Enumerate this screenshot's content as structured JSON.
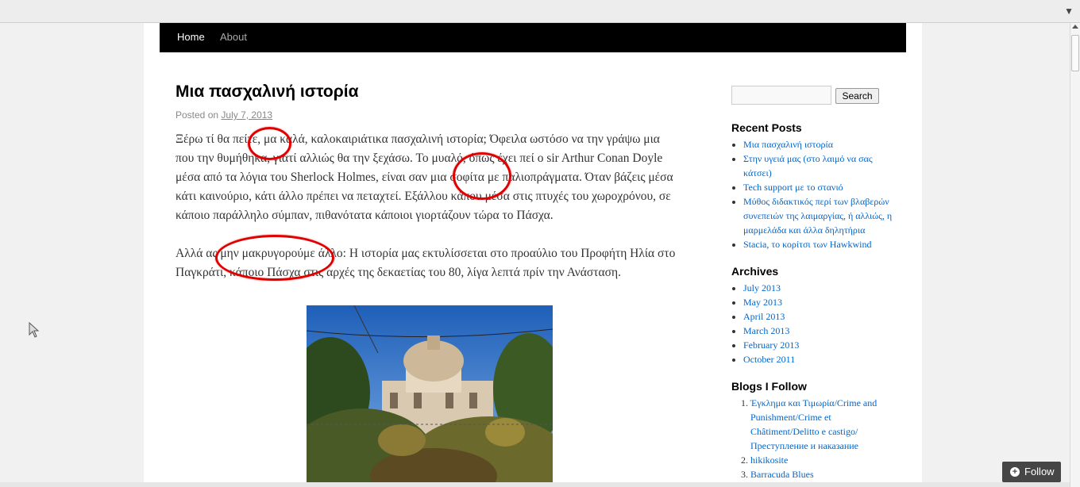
{
  "browser": {
    "dropdown_icon": "chevron-down-icon"
  },
  "nav": {
    "items": [
      {
        "label": "Home",
        "active": true
      },
      {
        "label": "About",
        "active": false
      }
    ]
  },
  "post": {
    "title": "Μια πασχαλινή ιστορία",
    "posted_on_label": "Posted on",
    "date": "July 7, 2013",
    "paragraphs": [
      "Ξέρω τί θα πείτε, μα καλά, καλοκαιριάτικα πασχαλινή ιστορία; Όφειλα ωστόσο να την γράψω μια που την θυμήθηκα, γιατί αλλιώς θα την ξεχάσω. Το μυαλό, όπως έχει πεί ο sir Arthur Conan Doyle μέσα από τα λόγια του Sherlock Holmes, είναι σαν μια σοφίτα με παλιοπράγματα. Όταν βάζεις μέσα κάτι καινούριο, κάτι άλλο πρέπει να πεταχτεί. Εξάλλου κάπου μέσα στις πτυχές του χωροχρόνου, σε κάποιο παράλληλο σύμπαν, πιθανότατα  κάποιοι γιορτάζουν τώρα το Πάσχα.",
      "Αλλά ας μην μακρυγορούμε άλλο: Η ιστορία μας εκτυλίσσεται στο προαύλιο του Προφήτη Ηλία στο Παγκράτι, κάποιο Πάσχα στις αρχές της δεκαετίας του 80, λίγα λεπτά πρίν την Ανάσταση."
    ]
  },
  "sidebar": {
    "search": {
      "placeholder": "",
      "button_label": "Search"
    },
    "recent_posts": {
      "title": "Recent Posts",
      "items": [
        "Μια πασχαλινή ιστορία",
        "Στην υγειά μας (στο λαιμό να σας κάτσει)",
        "Tech support με το στανιό",
        "Μύθος διδακτικός περί των βλαβερών συνεπειών της λαιμαργίας, ή αλλιώς, η μαρμελάδα και άλλα δηλητήρια",
        "Stacia, το κορίτσι των Hawkwind"
      ]
    },
    "archives": {
      "title": "Archives",
      "items": [
        "July 2013",
        "May 2013",
        "April 2013",
        "March 2013",
        "February 2013",
        "October 2011"
      ]
    },
    "blogs": {
      "title": "Blogs I Follow",
      "items": [
        "Έγκλημα και Τιμωρία/Crime and Punishment/Crime et Châtiment/Delitto e castigo/ Преступление и наказание",
        "hikikosite",
        "Barracuda Blues"
      ]
    }
  },
  "follow": {
    "label": "Follow",
    "icon": "plus-circle-icon"
  },
  "colors": {
    "nav_bg": "#000000",
    "link": "#0066cc",
    "annotation": "#e00000"
  }
}
